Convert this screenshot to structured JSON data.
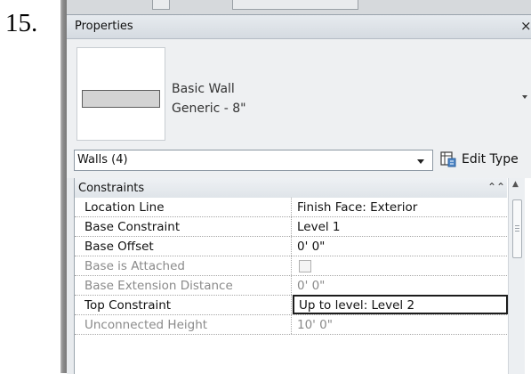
{
  "step_number": "15.",
  "panel": {
    "title": "Properties",
    "close_glyph": "×"
  },
  "type_selector": {
    "family": "Basic Wall",
    "type": "Generic - 8\""
  },
  "filter": {
    "selected": "Walls (4)"
  },
  "edit_type": {
    "label": "Edit Type"
  },
  "group": {
    "label": "Constraints",
    "collapse_glyph": "≈"
  },
  "properties": [
    {
      "name": "Location Line",
      "value": "Finish Face: Exterior",
      "enabled": true
    },
    {
      "name": "Base Constraint",
      "value": "Level 1",
      "enabled": true
    },
    {
      "name": "Base Offset",
      "value": "0'  0\"",
      "enabled": true
    },
    {
      "name": "Base is Attached",
      "value": "",
      "enabled": false,
      "control": "checkbox"
    },
    {
      "name": "Base Extension Distance",
      "value": "0'  0\"",
      "enabled": false
    },
    {
      "name": "Top Constraint",
      "value": "Up to level: Level 2",
      "enabled": true,
      "editing": true
    },
    {
      "name": "Unconnected Height",
      "value": "10'  0\"",
      "enabled": false
    }
  ],
  "colors": {
    "panel_bg": "#e8ebee",
    "titlebar": "#dde2e7",
    "disabled_text": "#8a8a8a"
  }
}
